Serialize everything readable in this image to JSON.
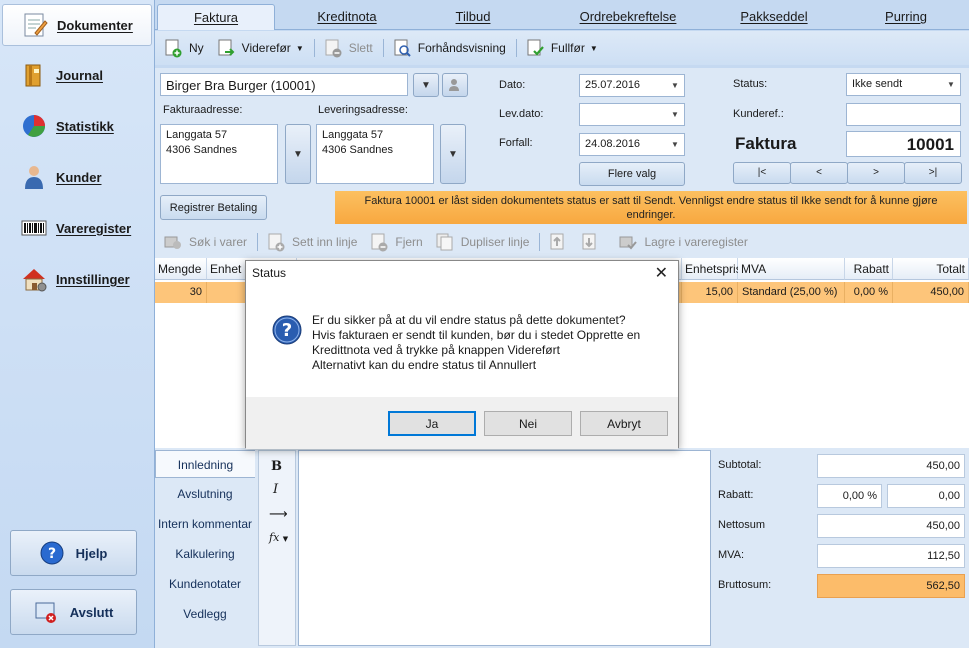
{
  "sidebar": {
    "items": [
      {
        "label": "Dokumenter",
        "icon": "document-edit-icon"
      },
      {
        "label": "Journal",
        "icon": "journal-book-icon"
      },
      {
        "label": "Statistikk",
        "icon": "pie-chart-icon"
      },
      {
        "label": "Kunder",
        "icon": "person-icon"
      },
      {
        "label": "Vareregister",
        "icon": "barcode-icon"
      },
      {
        "label": "Innstillinger",
        "icon": "house-settings-icon"
      }
    ],
    "help_label": "Hjelp",
    "exit_label": "Avslutt"
  },
  "tabs": [
    "Faktura",
    "Kreditnota",
    "Tilbud",
    "Ordrebekreftelse",
    "Pakkseddel",
    "Purring"
  ],
  "toolbar": {
    "new": "Ny",
    "forward": "Viderefør",
    "delete": "Slett",
    "preview": "Forhåndsvisning",
    "complete": "Fullfør"
  },
  "header": {
    "customer": "Birger Bra Burger (10001)",
    "invoice_address_label": "Fakturaadresse:",
    "invoice_address_line1": "Langgata 57",
    "invoice_address_line2": "4306 Sandnes",
    "delivery_address_label": "Leveringsadresse:",
    "delivery_address_line1": "Langgata 57",
    "delivery_address_line2": "4306 Sandnes",
    "date_label": "Dato:",
    "date_value": "25.07.2016",
    "delivery_date_label": "Lev.dato:",
    "delivery_date_value": "",
    "due_label": "Forfall:",
    "due_value": "24.08.2016",
    "more_options": "Flere valg",
    "status_label": "Status:",
    "status_value": "Ikke sendt",
    "customer_ref_label": "Kunderef.:",
    "customer_ref_value": "",
    "doc_type": "Faktura",
    "doc_number": "10001",
    "nav_first": "|<",
    "nav_prev": "<",
    "nav_next": ">",
    "nav_last": ">|",
    "register_payment": "Registrer Betaling",
    "locked_notice_line1": "Faktura 10001 er låst siden dokumentets status er satt til Sendt. Vennligst endre status til Ikke sendt for å kunne gjøre",
    "locked_notice_line2": "endringer."
  },
  "lines_toolbar": {
    "search": "Søk i varer",
    "insert": "Sett inn linje",
    "remove": "Fjern",
    "duplicate": "Dupliser linje",
    "save_register": "Lagre i vareregister"
  },
  "grid": {
    "headers": [
      "Mengde",
      "Enhet",
      "Enhetspris",
      "MVA",
      "Rabatt",
      "Totalt"
    ],
    "row": {
      "qty": "30",
      "unit_price": "15,00",
      "vat": "Standard (25,00 %)",
      "discount": "0,00 %",
      "total": "450,00"
    }
  },
  "bottom_tabs": [
    "Innledning",
    "Avslutning",
    "Intern kommentar",
    "Kalkulering",
    "Kundenotater",
    "Vedlegg"
  ],
  "editor_tools": {
    "bold": "B",
    "italic": "I",
    "indent": "⟶",
    "formula": "fx"
  },
  "summary": {
    "subtotal_label": "Subtotal:",
    "subtotal": "450,00",
    "discount_label": "Rabatt:",
    "discount_pct": "0,00 %",
    "discount_amount": "0,00",
    "net_label": "Nettosum",
    "net": "450,00",
    "vat_label": "MVA:",
    "vat": "112,50",
    "gross_label": "Bruttosum:",
    "gross": "562,50"
  },
  "dialog": {
    "title": "Status",
    "close": "✕",
    "line1": "Er du sikker på at du vil endre status på dette dokumentet?",
    "line2": "Hvis fakturaen er sendt til kunden, bør du i stedet Opprette en",
    "line3": "Kredittnota ved å trykke på knappen Videreført",
    "line4": "Alternativt kan du endre status til Annullert",
    "yes": "Ja",
    "no": "Nei",
    "cancel": "Avbryt"
  },
  "colors": {
    "accent_orange": "#fdc57a",
    "notice_orange": "#fbb04f",
    "sidebar_blue": "#c5d9f1",
    "dialog_icon_blue": "#2a5db0"
  }
}
